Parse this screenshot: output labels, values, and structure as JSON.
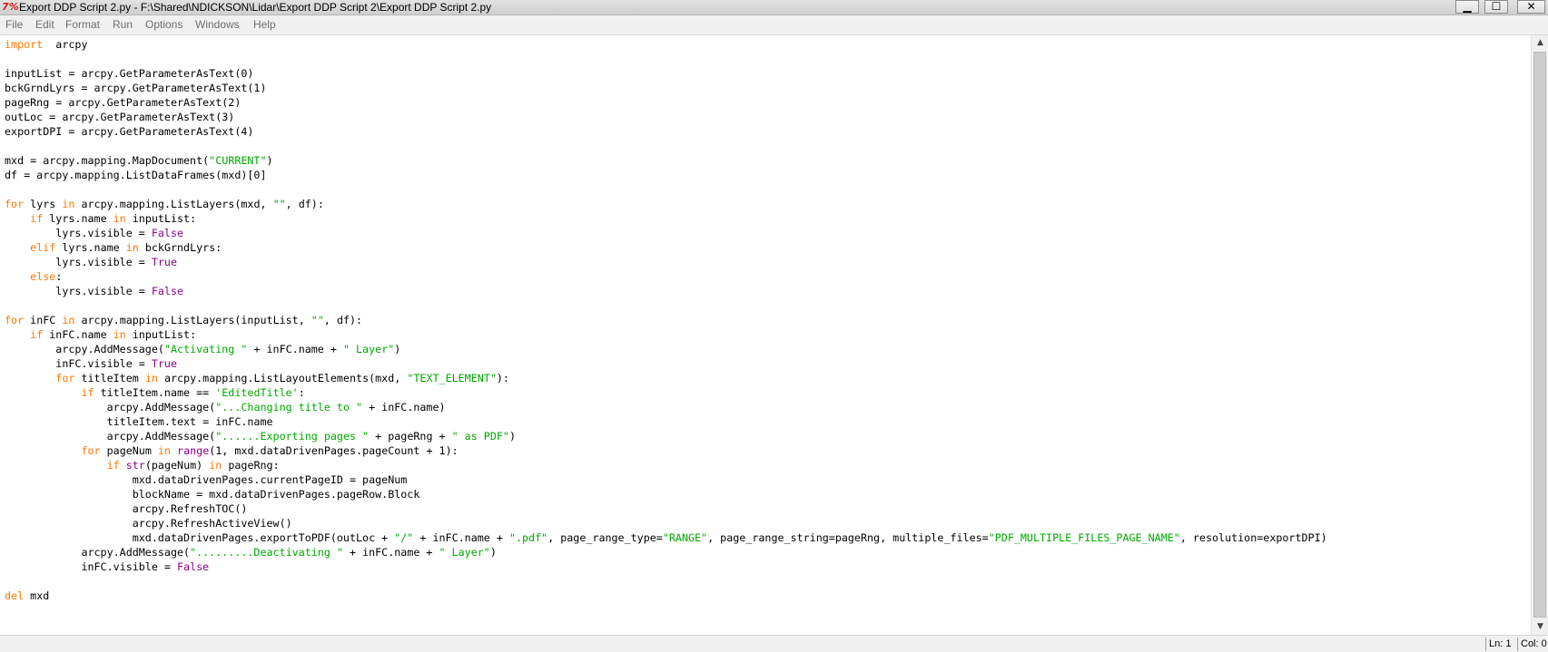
{
  "window": {
    "title": "Export DDP Script 2.py - F:\\Shared\\NDICKSON\\Lidar\\Export DDP Script 2\\Export DDP Script 2.py",
    "app_icon": "python-idle-icon",
    "minimize_label": "▁",
    "maximize_label": "☐",
    "close_label": "✕"
  },
  "menu": {
    "items": [
      "File",
      "Edit",
      "Format",
      "Run",
      "Options",
      "Windows",
      "Help"
    ]
  },
  "colors": {
    "keyword": "#ff7700",
    "builtin": "#900090",
    "string": "#00aa00",
    "default": "#000000"
  },
  "editor": {
    "lines": [
      [
        [
          "kw",
          "import"
        ],
        [
          "",
          "  arcpy"
        ]
      ],
      [],
      [
        [
          "",
          "inputList = arcpy.GetParameterAsText(0)"
        ]
      ],
      [
        [
          "",
          "bckGrndLyrs = arcpy.GetParameterAsText(1)"
        ]
      ],
      [
        [
          "",
          "pageRng = arcpy.GetParameterAsText(2)"
        ]
      ],
      [
        [
          "",
          "outLoc = arcpy.GetParameterAsText(3)"
        ]
      ],
      [
        [
          "",
          "exportDPI = arcpy.GetParameterAsText(4)"
        ]
      ],
      [],
      [
        [
          "",
          "mxd = arcpy.mapping.MapDocument("
        ],
        [
          "str",
          "\"CURRENT\""
        ],
        [
          "",
          ")"
        ]
      ],
      [
        [
          "",
          "df = arcpy.mapping.ListDataFrames(mxd)[0]"
        ]
      ],
      [],
      [
        [
          "kw",
          "for"
        ],
        [
          "",
          " lyrs "
        ],
        [
          "kw",
          "in"
        ],
        [
          "",
          "",
          " arcpy.mapping.ListLayers(mxd, "
        ],
        [
          "str",
          "\"\""
        ],
        [
          "",
          ", df):"
        ]
      ],
      [
        [
          "",
          "    "
        ],
        [
          "kw",
          "if"
        ],
        [
          "",
          " lyrs.name "
        ],
        [
          "kw",
          "in"
        ],
        [
          "",
          " inputList:"
        ]
      ],
      [
        [
          "",
          "        lyrs.visible = "
        ],
        [
          "bi",
          "False"
        ]
      ],
      [
        [
          "",
          "    "
        ],
        [
          "kw",
          "elif"
        ],
        [
          "",
          " lyrs.name "
        ],
        [
          "kw",
          "in"
        ],
        [
          "",
          " bckGrndLyrs:"
        ]
      ],
      [
        [
          "",
          "        lyrs.visible = "
        ],
        [
          "bi",
          "True"
        ]
      ],
      [
        [
          "",
          "    "
        ],
        [
          "kw",
          "else"
        ],
        [
          "",
          ":"
        ]
      ],
      [
        [
          "",
          "        lyrs.visible = "
        ],
        [
          "bi",
          "False"
        ]
      ],
      [],
      [
        [
          "kw",
          "for"
        ],
        [
          "",
          " inFC "
        ],
        [
          "kw",
          "in"
        ],
        [
          "",
          " arcpy.mapping.ListLayers(inputList, "
        ],
        [
          "str",
          "\"\""
        ],
        [
          "",
          ", df):"
        ]
      ],
      [
        [
          "",
          "    "
        ],
        [
          "kw",
          "if"
        ],
        [
          "",
          " inFC.name "
        ],
        [
          "kw",
          "in"
        ],
        [
          "",
          " inputList:"
        ]
      ],
      [
        [
          "",
          "        arcpy.AddMessage("
        ],
        [
          "str",
          "\"Activating \""
        ],
        [
          "",
          " + inFC.name + "
        ],
        [
          "str",
          "\" Layer\""
        ],
        [
          "",
          ")"
        ]
      ],
      [
        [
          "",
          "        inFC.visible = "
        ],
        [
          "bi",
          "True"
        ]
      ],
      [
        [
          "",
          "        "
        ],
        [
          "kw",
          "for"
        ],
        [
          "",
          " titleItem "
        ],
        [
          "kw",
          "in"
        ],
        [
          "",
          " arcpy.mapping.ListLayoutElements(mxd, "
        ],
        [
          "str",
          "\"TEXT_ELEMENT\""
        ],
        [
          "",
          "):"
        ]
      ],
      [
        [
          "",
          "            "
        ],
        [
          "kw",
          "if"
        ],
        [
          "",
          " titleItem.name == "
        ],
        [
          "str",
          "'EditedTitle'"
        ],
        [
          "",
          ":"
        ]
      ],
      [
        [
          "",
          "                arcpy.AddMessage("
        ],
        [
          "str",
          "\"...Changing title to \""
        ],
        [
          "",
          " + inFC.name)"
        ]
      ],
      [
        [
          "",
          "                titleItem.text = inFC.name"
        ]
      ],
      [
        [
          "",
          "                arcpy.AddMessage("
        ],
        [
          "str",
          "\"......Exporting pages \""
        ],
        [
          "",
          " + pageRng + "
        ],
        [
          "str",
          "\" as PDF\""
        ],
        [
          "",
          ")"
        ]
      ],
      [
        [
          "",
          "            "
        ],
        [
          "kw",
          "for"
        ],
        [
          "",
          " pageNum "
        ],
        [
          "kw",
          "in"
        ],
        [
          "",
          "",
          " "
        ],
        [
          "bi",
          "range"
        ],
        [
          "",
          "(1, mxd.dataDrivenPages.pageCount + 1):"
        ]
      ],
      [
        [
          "",
          "                "
        ],
        [
          "kw",
          "if"
        ],
        [
          "",
          " "
        ],
        [
          "bi",
          "str"
        ],
        [
          "",
          "(pageNum) "
        ],
        [
          "kw",
          "in"
        ],
        [
          "",
          " pageRng:"
        ]
      ],
      [
        [
          "",
          "                    mxd.dataDrivenPages.currentPageID = pageNum"
        ]
      ],
      [
        [
          "",
          "                    blockName = mxd.dataDrivenPages.pageRow.Block"
        ]
      ],
      [
        [
          "",
          "                    arcpy.RefreshTOC()"
        ]
      ],
      [
        [
          "",
          "                    arcpy.RefreshActiveView()"
        ]
      ],
      [
        [
          "",
          "                    mxd.dataDrivenPages.exportToPDF(outLoc + "
        ],
        [
          "str",
          "\"/\""
        ],
        [
          "",
          " + inFC.name + "
        ],
        [
          "str",
          "\".pdf\""
        ],
        [
          "",
          ", page_range_type="
        ],
        [
          "str",
          "\"RANGE\""
        ],
        [
          "",
          ", page_range_string=pageRng, multiple_files="
        ],
        [
          "str",
          "\"PDF_MULTIPLE_FILES_PAGE_NAME\""
        ],
        [
          "",
          ", resolution=exportDPI)"
        ]
      ],
      [
        [
          "",
          "            arcpy.AddMessage("
        ],
        [
          "str",
          "\".........Deactivating \""
        ],
        [
          "",
          " + inFC.name + "
        ],
        [
          "str",
          "\" Layer\""
        ],
        [
          "",
          ")"
        ]
      ],
      [
        [
          "",
          "            inFC.visible = "
        ],
        [
          "bi",
          "False"
        ]
      ],
      [],
      [
        [
          "kw",
          "del"
        ],
        [
          "",
          " mxd"
        ]
      ]
    ]
  },
  "scrollbar": {
    "up_icon": "scroll-up-arrow-icon",
    "down_icon": "scroll-down-arrow-icon",
    "up_glyph": "▲",
    "down_glyph": "▼"
  },
  "status": {
    "line": "Ln: 1",
    "col": "Col: 0"
  }
}
